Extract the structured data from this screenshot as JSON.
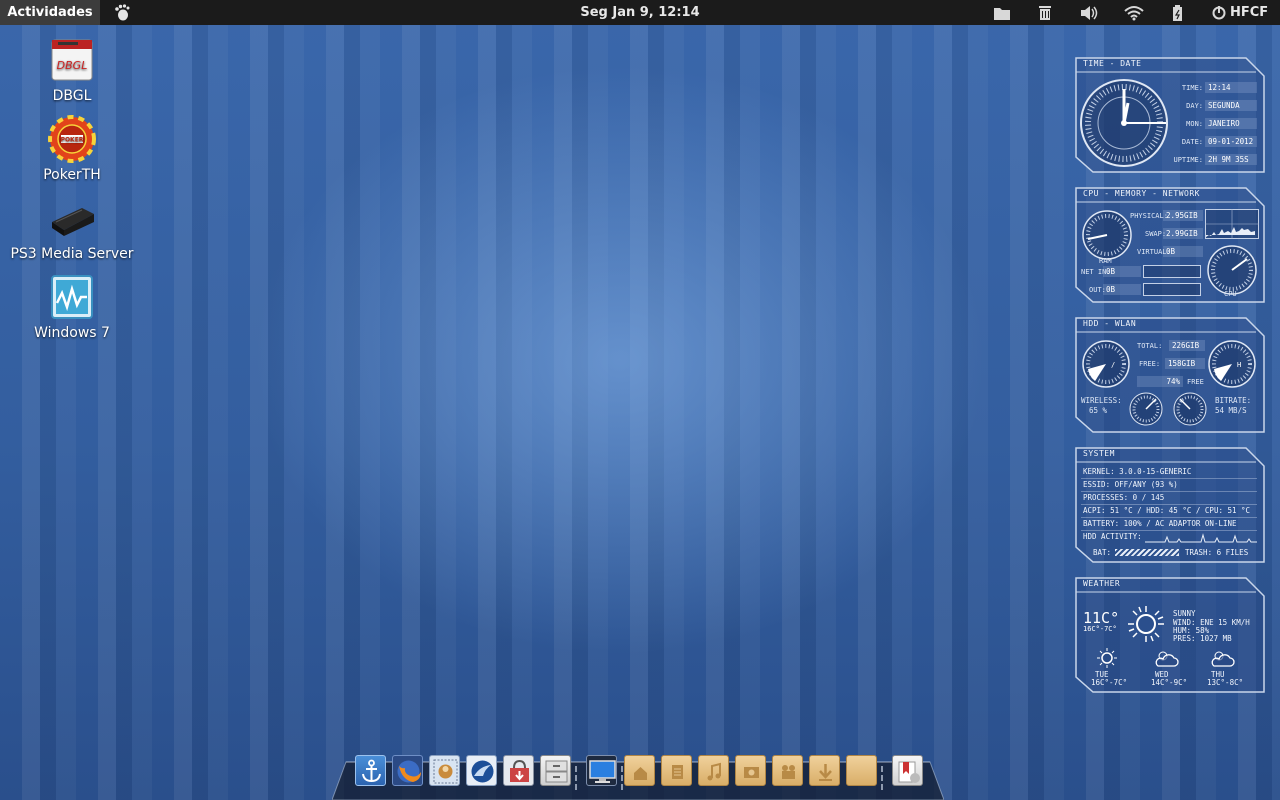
{
  "panel": {
    "activities": "Actividades",
    "clock": "Seg Jan  9, 12:14",
    "user": "HFCF"
  },
  "desktop_icons": [
    {
      "label": "DBGL",
      "logo_text": "DBGL"
    },
    {
      "label": "PokerTH",
      "logo_text": "POKER"
    },
    {
      "label": "PS3 Media Server"
    },
    {
      "label": "Windows 7"
    }
  ],
  "widgets": {
    "time_date": {
      "title": "TIME - DATE",
      "rows": [
        {
          "label": "TIME:",
          "value": "12:14"
        },
        {
          "label": "DAY:",
          "value": "SEGUNDA"
        },
        {
          "label": "MON:",
          "value": "JANEIRO"
        },
        {
          "label": "DATE:",
          "value": "09-01-2012"
        },
        {
          "label": "UPTIME:",
          "value": "2H 9M 35S"
        }
      ]
    },
    "cpu_mem_net": {
      "title": "CPU - MEMORY - NETWORK",
      "physical_label": "PHYSICAL:",
      "physical": "2.95GiB",
      "swap_label": "SWAP:",
      "swap": "2.99GiB",
      "virtual_label": "VIRTUAL:",
      "virtual": "0B",
      "ram_label": "RAM",
      "net_in_label": "NET IN:",
      "net_in": "0B",
      "out_label": "OUT:",
      "out": "0B",
      "cpu_label": "CPU"
    },
    "hdd_wlan": {
      "title": "HDD - WLAN",
      "total_label": "TOTAL:",
      "total": "226GiB",
      "free_label": "FREE:",
      "free": "158GiB",
      "percent": "74%",
      "percent_label": "FREE",
      "gauge_left": "/",
      "gauge_right": "H",
      "wireless_label": "WIRELESS:",
      "wireless": "65 %",
      "bitrate_label": "BITRATE:",
      "bitrate": "54 MB/S"
    },
    "system": {
      "title": "SYSTEM",
      "lines": [
        "KERNEL: 3.0.0-15-GENERIC",
        "ESSID: OFF/ANY (93 %)",
        "PROCESSES: 0 / 145",
        "ACPI: 51 °C / HDD: 45 °C / CPU: 51 °C",
        "BATTERY: 100% / AC ADAPTOR ON-LINE",
        "HDD ACTIVITY:"
      ],
      "bat_label": "BAT:",
      "trash": "TRASH: 6 FILES"
    },
    "weather": {
      "title": "WEATHER",
      "temp": "11C°",
      "range": "16C°-7C°",
      "condition": "SUNNY",
      "wind": "WIND: ENE 15 KM/H",
      "hum": "HUM: 58%",
      "pres": "PRES: 1027 MB",
      "forecast": [
        {
          "day": "TUE",
          "range": "16C°-7C°"
        },
        {
          "day": "WED",
          "range": "14C°-9C°"
        },
        {
          "day": "THU",
          "range": "13C°-8C°"
        }
      ]
    }
  },
  "dock": {
    "items": [
      "anchor-icon",
      "firefox-icon",
      "mail-stamp-icon",
      "thunderbird-icon",
      "software-center-icon",
      "file-cabinet-icon",
      "monitor-icon",
      "home-folder-icon",
      "documents-folder-icon",
      "music-folder-icon",
      "pictures-folder-icon",
      "videos-folder-icon",
      "downloads-folder-icon",
      "folder-icon",
      "trash-bookmark-icon"
    ]
  },
  "colors": {
    "panel": "#1b1b1b",
    "wallpaper": "#3a67ab",
    "widget_border": "#c9d6ea"
  }
}
